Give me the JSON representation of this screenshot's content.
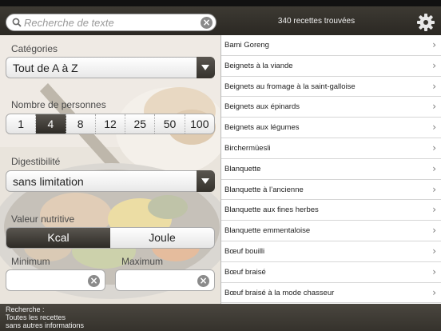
{
  "search": {
    "placeholder": "Recherche de texte",
    "value": ""
  },
  "header": {
    "result_count": "340 recettes trouvées"
  },
  "filters": {
    "categories_label": "Catégories",
    "category_value": "Tout de A à Z",
    "persons_label": "Nombre de personnes",
    "persons_options": [
      "1",
      "4",
      "8",
      "12",
      "25",
      "50",
      "100"
    ],
    "persons_selected": "4",
    "digestibility_label": "Digestibilité",
    "digestibility_value": "sans limitation",
    "nutrition_label": "Valeur nutritive",
    "nutrition_options": [
      "Kcal",
      "Joule"
    ],
    "nutrition_selected": "Kcal",
    "minimum_label": "Minimum",
    "maximum_label": "Maximum",
    "minimum_value": "",
    "maximum_value": ""
  },
  "recipes": [
    "Bami Goreng",
    "Beignets à la viande",
    "Beignets au fromage à la saint-galloise",
    "Beignets aux épinards",
    "Beignets aux légumes",
    "Birchermüesli",
    "Blanquette",
    "Blanquette à l’ancienne",
    "Blanquette aux fines herbes",
    "Blanquette emmentaloise",
    "Bœuf bouilli",
    "Bœuf braisé",
    "Bœuf braisé à la mode chasseur"
  ],
  "footer": {
    "line1": "Recherche :",
    "line2": "Toutes les recettes",
    "line3": "sans autres informations"
  },
  "icons": {
    "search": "search-icon",
    "clear": "clear-icon",
    "settings": "gear-icon",
    "chevron": "chevron-right-icon",
    "dropdown": "dropdown-arrow-icon"
  },
  "colors": {
    "bar_dark": "#35322c",
    "selected_segment": "#2e2b26",
    "list_bg": "#ffffff"
  }
}
